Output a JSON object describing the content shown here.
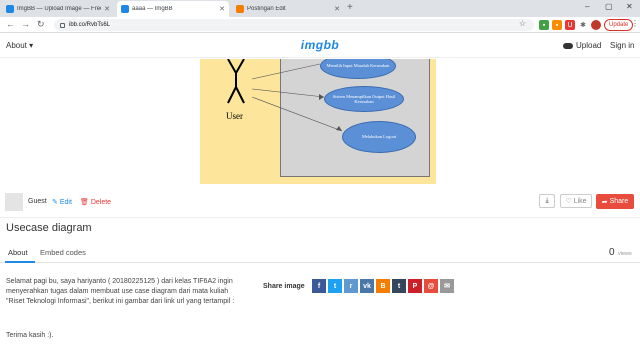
{
  "browser": {
    "tabs": [
      {
        "title": "ImgBB — Upload Image — Free Image..."
      },
      {
        "title": "aaaa — ImgBB"
      },
      {
        "title": "Postingan Edit"
      }
    ],
    "url": "ibb.co/RvbTs6L",
    "update_label": "Update"
  },
  "header": {
    "about_label": "About",
    "logo_text": "imgbb",
    "upload_label": "Upload",
    "signin_label": "Sign in"
  },
  "image": {
    "actor_label": "User",
    "use_cases": [
      "Memilih Input Masalah Kerusakan",
      "Sistem Menampilkan Output Hasil Kerusakan",
      "Melakukan Logout"
    ]
  },
  "author": {
    "name": "Guest",
    "edit_label": "Edit",
    "delete_label": "Delete",
    "like_label": "Like",
    "share_label": "Share"
  },
  "content": {
    "title": "Usecase diagram",
    "tabs": [
      "About",
      "Embed codes"
    ],
    "views_count": "0",
    "views_label": "views",
    "description": "Selamat pagi bu, saya hariyanto ( 20180225125 ) dari kelas TIF6A2 ingin menyerahkan tugas dalam membuat use case diagram dari mata kuliah \"Riset Teknologi Informasi\", berikut ini gambar dari link url yang tertampil :",
    "thanks": "Terima kasih :).",
    "share_image_label": "Share image"
  },
  "share_icons": [
    {
      "name": "facebook-icon",
      "glyph": "f",
      "color": "#3b5998"
    },
    {
      "name": "twitter-icon",
      "glyph": "t",
      "color": "#1da1f2"
    },
    {
      "name": "reddit-icon",
      "glyph": "r",
      "color": "#5f99cf"
    },
    {
      "name": "vk-icon",
      "glyph": "vk",
      "color": "#4a76a8"
    },
    {
      "name": "blogger-icon",
      "glyph": "B",
      "color": "#f57d00"
    },
    {
      "name": "tumblr-icon",
      "glyph": "t",
      "color": "#35465c"
    },
    {
      "name": "pinterest-icon",
      "glyph": "P",
      "color": "#cb2027"
    },
    {
      "name": "linkedin-icon",
      "glyph": "@",
      "color": "#e74c3c"
    },
    {
      "name": "email-icon",
      "glyph": "✉",
      "color": "#999999"
    }
  ]
}
